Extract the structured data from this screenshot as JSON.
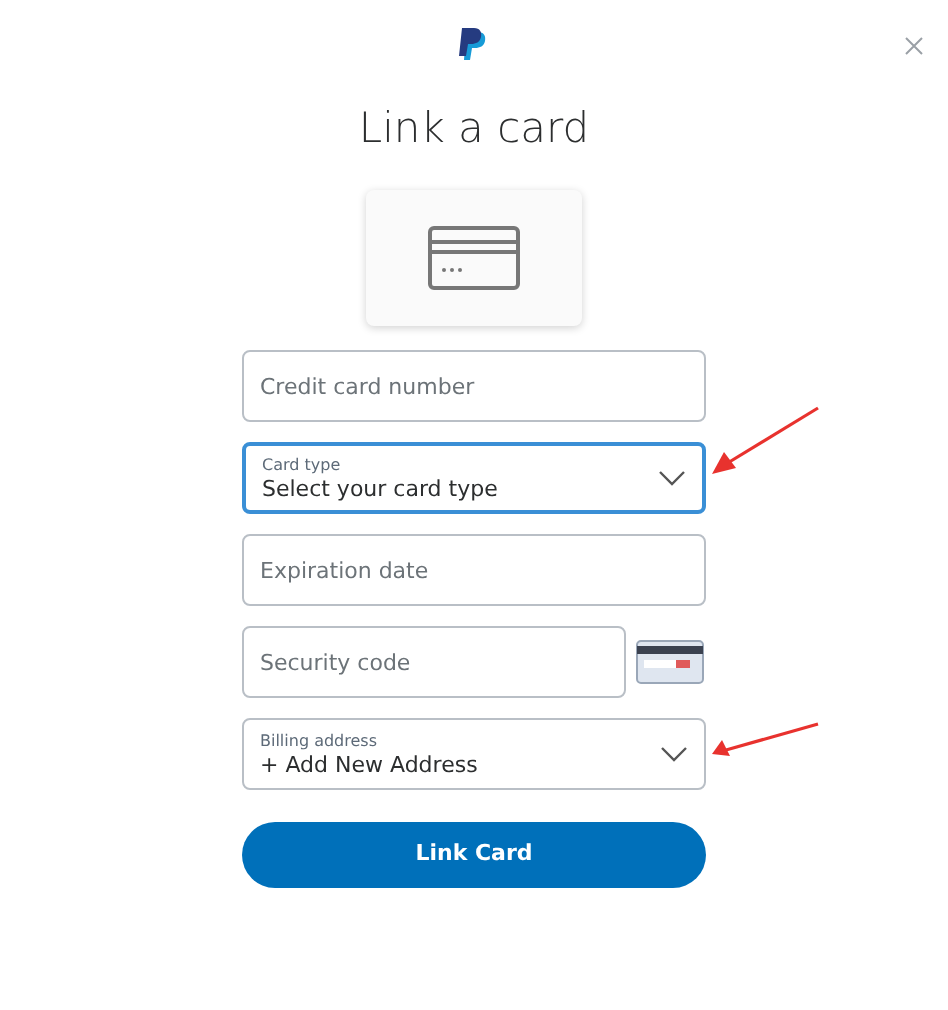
{
  "title": "Link a card",
  "fields": [
    {
      "kind": "text",
      "placeholder": "Credit card number",
      "focused": false,
      "annotated": false
    },
    {
      "kind": "select",
      "label": "Card type",
      "value": "Select your card type",
      "focused": true,
      "annotated": true
    },
    {
      "kind": "text",
      "placeholder": "Expiration date",
      "focused": false,
      "annotated": false
    },
    {
      "kind": "security",
      "placeholder": "Security code",
      "focused": false,
      "annotated": false
    },
    {
      "kind": "select",
      "label": "Billing address",
      "value": "+ Add New Address",
      "focused": false,
      "annotated": true
    }
  ],
  "submit": "Link Card"
}
